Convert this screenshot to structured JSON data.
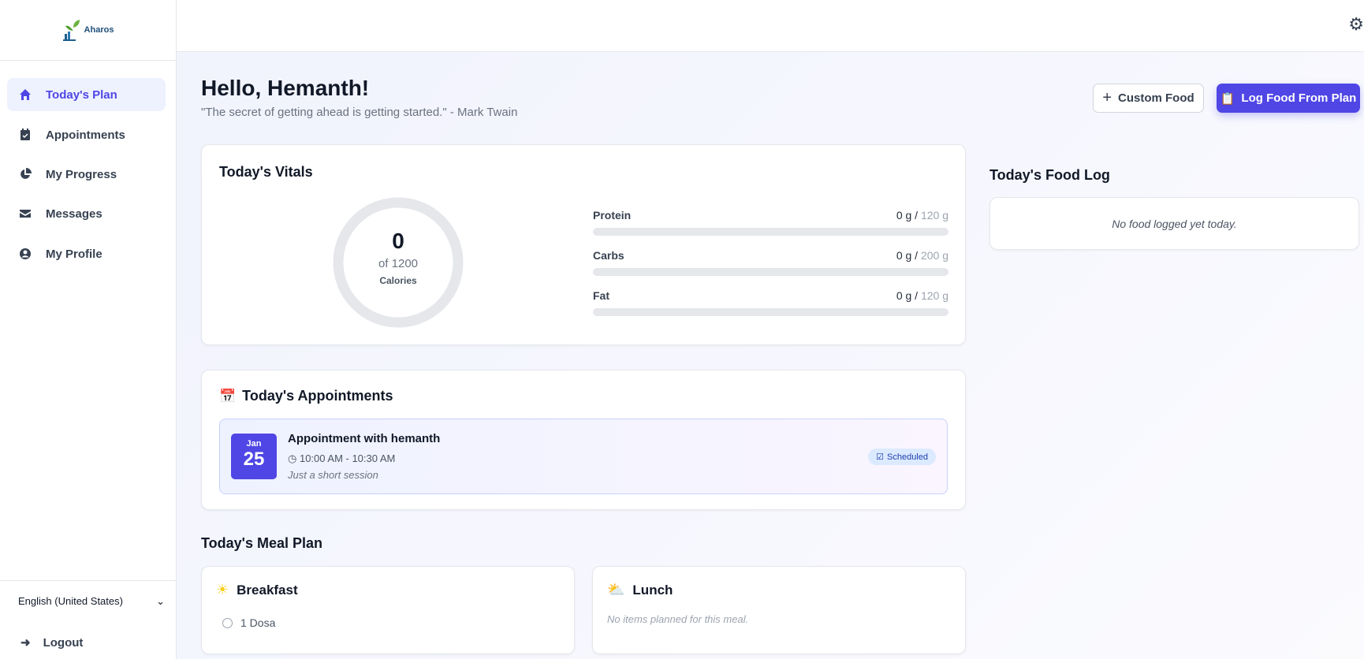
{
  "brand": {
    "name": "Aharos"
  },
  "sidebar": {
    "items": [
      {
        "label": "Today's Plan",
        "icon": "home-icon",
        "active": true
      },
      {
        "label": "Appointments",
        "icon": "calendar-check-icon"
      },
      {
        "label": "My Progress",
        "icon": "pie-chart-icon"
      },
      {
        "label": "Messages",
        "icon": "envelope-icon"
      },
      {
        "label": "My Profile",
        "icon": "user-circle-icon"
      }
    ],
    "language": "English (United States)",
    "logout": "Logout"
  },
  "header": {
    "settings_icon": "gear-icon"
  },
  "greeting": {
    "title": "Hello, Hemanth!",
    "quote": "\"The secret of getting ahead is getting started.\" - Mark Twain"
  },
  "actions": {
    "custom_food": "Custom Food",
    "log_food": "Log Food From Plan"
  },
  "vitals": {
    "title": "Today's Vitals",
    "calories": "0",
    "calories_of": "of 1200",
    "calories_label": "Calories",
    "calorie_progress": 0,
    "macros": [
      {
        "name": "Protein",
        "value": "0 g /",
        "goal": " 120 g",
        "progress": 0
      },
      {
        "name": "Carbs",
        "value": "0 g /",
        "goal": " 200 g",
        "progress": 0
      },
      {
        "name": "Fat",
        "value": "0 g /",
        "goal": " 120 g",
        "progress": 0
      }
    ]
  },
  "appointments": {
    "title": "Today's Appointments",
    "items": [
      {
        "month": "Jan",
        "day": "25",
        "title": "Appointment with hemanth",
        "time": "10:00 AM - 10:30 AM",
        "note": "Just a short session",
        "status": "Scheduled"
      }
    ]
  },
  "meal_plan": {
    "title": "Today's Meal Plan",
    "meals": [
      {
        "name": "Breakfast",
        "icon": "sun-icon",
        "items": [
          "1 Dosa"
        ]
      },
      {
        "name": "Lunch",
        "icon": "cloud-sun-icon",
        "empty": "No items planned for this meal."
      }
    ]
  },
  "food_log": {
    "title": "Today's Food Log",
    "empty": "No food logged yet today."
  },
  "colors": {
    "accent": "#4f46e5",
    "badge_bg": "#dbeafe"
  }
}
